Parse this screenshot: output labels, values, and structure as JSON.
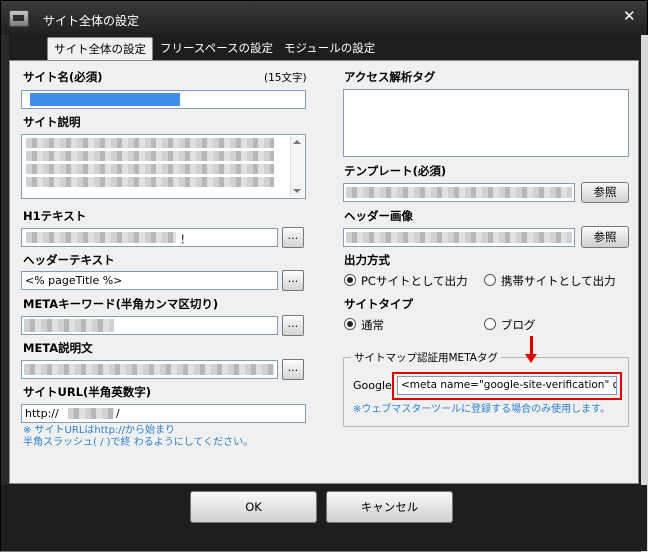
{
  "window": {
    "title": "サイト全体の設定"
  },
  "tabs": [
    {
      "label": "サイト全体の設定",
      "active": true
    },
    {
      "label": "フリースペースの設定",
      "active": false
    },
    {
      "label": "モジュールの設定",
      "active": false
    }
  ],
  "left": {
    "site_name": {
      "label": "サイト名(必須)",
      "hint": "(15文字)"
    },
    "site_description": {
      "label": "サイト説明"
    },
    "h1_text": {
      "label": "H1テキスト",
      "value_suffix": "！"
    },
    "header_text": {
      "label": "ヘッダーテキスト",
      "value": "<% pageTitle %>"
    },
    "meta_keywords": {
      "label": "METAキーワード(半角カンマ区切り)"
    },
    "meta_description": {
      "label": "META説明文"
    },
    "site_url": {
      "label": "サイトURL(半角英数字)",
      "value_prefix": "http://",
      "value_suffix": "/",
      "note_line1": "※ サイトURLはhttp://から始まり",
      "note_line2": "半角スラッシュ( / )で終 わるようにしてください。"
    },
    "browse_label": "..."
  },
  "right": {
    "access_tag": {
      "label": "アクセス解析タグ"
    },
    "template": {
      "label": "テンプレート(必須)",
      "browse_button": "参照"
    },
    "header_image": {
      "label": "ヘッダー画像",
      "browse_button": "参照"
    },
    "output_mode": {
      "label": "出力方式",
      "options": [
        {
          "label": "PCサイトとして出力",
          "selected": true
        },
        {
          "label": "携帯サイトとして出力",
          "selected": false
        }
      ]
    },
    "site_type": {
      "label": "サイトタイプ",
      "options": [
        {
          "label": "通常",
          "selected": true
        },
        {
          "label": "ブログ",
          "selected": false
        }
      ]
    },
    "sitemap_group": {
      "title": "サイトマップ認証用METAタグ",
      "google_label": "Google",
      "google_value": "<meta name=\"google-site-verification\" c",
      "note": "※ウェブマスターツールに登録する場合のみ使用します。"
    }
  },
  "footer": {
    "ok_label": "OK",
    "cancel_label": "キャンセル"
  },
  "colors": {
    "highlight": "#e00000",
    "note": "#2a7fcf",
    "title_bar": "#2a2a2a"
  },
  "icons": {
    "app": "app-window-icon",
    "close": "close-icon"
  }
}
